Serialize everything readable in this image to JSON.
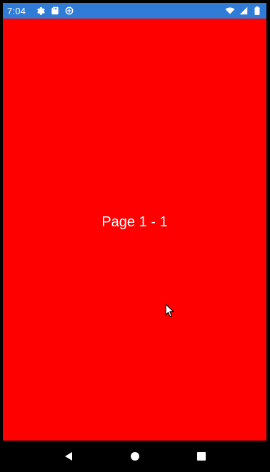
{
  "status_bar": {
    "time": "7:04",
    "bg_color": "#2f7bd6",
    "left_icons": [
      "gear-icon",
      "sd-card-icon",
      "data-saver-icon"
    ],
    "right_icons": [
      "wifi-icon",
      "cell-signal-icon",
      "battery-icon"
    ]
  },
  "page": {
    "label": "Page 1 - 1",
    "bg_color": "#ff0000"
  },
  "nav_bar": {
    "buttons": [
      "back-icon",
      "home-icon",
      "recents-icon"
    ]
  }
}
